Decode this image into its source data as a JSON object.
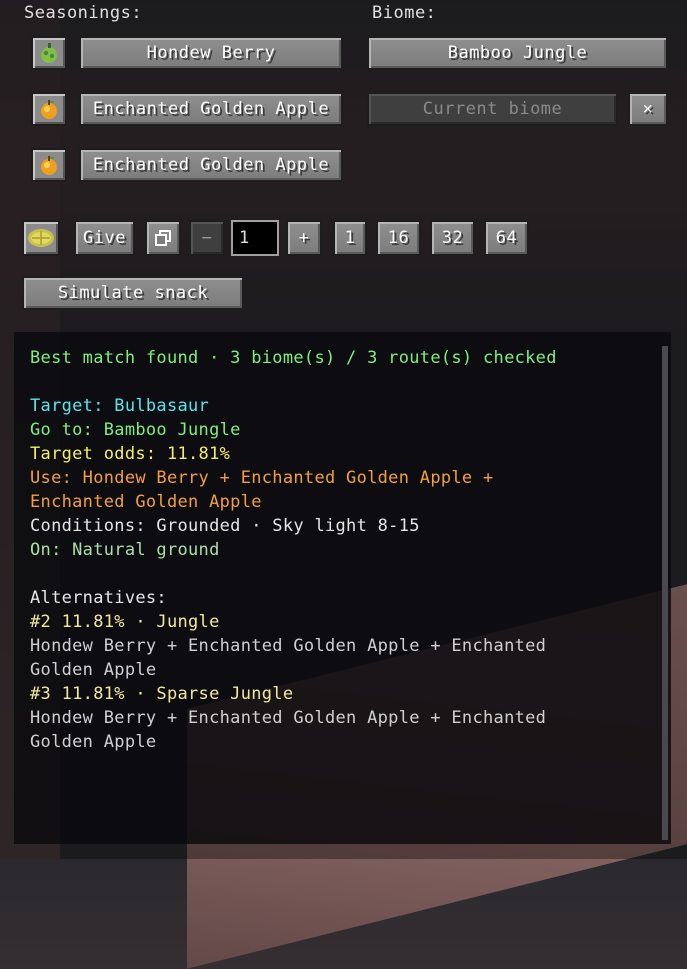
{
  "labels": {
    "seasonings": "Seasonings:",
    "biome": "Biome:"
  },
  "seasonings": [
    {
      "name": "Hondew Berry",
      "icon": "hondew-berry-icon"
    },
    {
      "name": "Enchanted Golden Apple",
      "icon": "golden-apple-icon"
    },
    {
      "name": "Enchanted Golden Apple",
      "icon": "golden-apple-icon"
    }
  ],
  "biome": {
    "selected": "Bamboo Jungle",
    "current_placeholder": "Current biome",
    "clear_label": "×"
  },
  "give_row": {
    "snack_icon": "poke-snack-icon",
    "give_label": "Give",
    "copy_icon": "copy-icon",
    "minus_label": "−",
    "quantity": "1",
    "plus_label": "+",
    "presets": [
      "1",
      "16",
      "32",
      "64"
    ]
  },
  "simulate_label": "Simulate snack",
  "output": {
    "summary": "Best match found · 3 biome(s) / 3 route(s) checked",
    "target": "Target: Bulbasaur",
    "goto": "Go to: Bamboo Jungle",
    "odds": "Target odds: 11.81%",
    "use_line1": "Use: Hondew Berry + Enchanted Golden Apple +",
    "use_line2": "Enchanted Golden Apple",
    "conditions": "Conditions: Grounded · Sky light 8-15",
    "on": "On: Natural ground",
    "alternatives_label": "Alternatives:",
    "alternatives": [
      {
        "header": "#2  11.81%  ·  Jungle",
        "line1": "Hondew Berry + Enchanted Golden Apple + Enchanted",
        "line2": "Golden Apple"
      },
      {
        "header": "#3  11.81%  ·  Sparse Jungle",
        "line1": "Hondew Berry + Enchanted Golden Apple + Enchanted",
        "line2": "Golden Apple"
      }
    ]
  },
  "colors": {
    "summary": "#7ef07e",
    "target": "#56e6f0",
    "goto": "#7ef07e",
    "odds": "#f5f060",
    "use": "#f3a03a"
  }
}
